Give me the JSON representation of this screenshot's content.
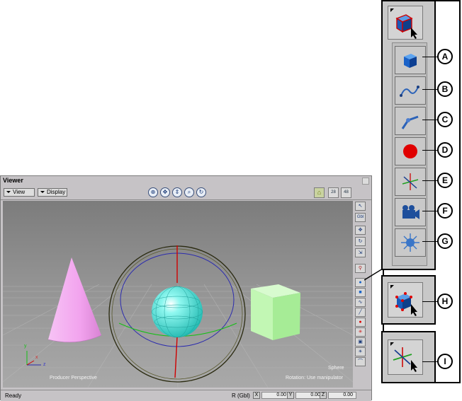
{
  "viewer": {
    "title": "Viewer",
    "menus": [
      {
        "label": "View"
      },
      {
        "label": "Display"
      }
    ],
    "nav_icons": [
      "pan-icon",
      "track-icon",
      "dolly-icon",
      "zoom-icon",
      "orbit-icon"
    ],
    "right_tools": {
      "snap": "⌂",
      "frame": "28",
      "grid": "48"
    },
    "viewport": {
      "camera_label": "Producer Perspective",
      "selection_label": "Sphere",
      "rotation_hint": "Rotation: Use manipulator",
      "axis_labels": {
        "x": "x",
        "y": "y",
        "z": "z"
      }
    },
    "mini_toolbar": {
      "items": [
        {
          "icon": "select-arrow-icon",
          "glyph": "↖"
        },
        {
          "icon": "global-local-icon",
          "glyph": "Gbl"
        },
        {
          "icon": "translate-icon",
          "glyph": "✥"
        },
        {
          "icon": "rotate-icon",
          "glyph": "↻"
        },
        {
          "icon": "scale-icon",
          "glyph": "⇲"
        },
        {
          "icon": "magnet-icon",
          "glyph": "⚲"
        },
        {
          "icon": "create-primitive-icon",
          "glyph": "●"
        },
        {
          "icon": "cube-icon",
          "glyph": "■"
        },
        {
          "icon": "curve-icon",
          "glyph": "∿"
        },
        {
          "icon": "skeleton-icon",
          "glyph": "╱"
        },
        {
          "icon": "marker-icon",
          "glyph": "●"
        },
        {
          "icon": "null-icon",
          "glyph": "✳"
        },
        {
          "icon": "camera-icon",
          "glyph": "▣"
        },
        {
          "icon": "light-icon",
          "glyph": "☀"
        },
        {
          "icon": "path-icon",
          "glyph": "⌒"
        }
      ]
    },
    "status": {
      "text": "Ready",
      "coord_mode": "R (Gbl)",
      "x_label": "X",
      "x_value": "0.00",
      "y_label": "Y",
      "y_value": "0.00",
      "z_label": "Z",
      "z_value": "0.00"
    }
  },
  "callouts": {
    "items": [
      {
        "letter": "A",
        "icon": "cube-icon",
        "color": "#1560c8"
      },
      {
        "letter": "B",
        "icon": "curve-icon",
        "color": "#2b62b8"
      },
      {
        "letter": "C",
        "icon": "skeleton-icon",
        "color": "#2b62b8"
      },
      {
        "letter": "D",
        "icon": "marker-icon",
        "color": "#e00000"
      },
      {
        "letter": "E",
        "icon": "null-icon",
        "color": "#cc2020"
      },
      {
        "letter": "F",
        "icon": "camera-icon",
        "color": "#1e4f9c"
      },
      {
        "letter": "G",
        "icon": "light-icon",
        "color": "#3a76c8"
      },
      {
        "letter": "H",
        "icon": "primitive-select-icon",
        "color": "#1560c8"
      },
      {
        "letter": "I",
        "icon": "null-select-icon",
        "color": "#cc2020"
      }
    ]
  },
  "colors": {
    "cone": "#f3a6ef",
    "sphere": "#5ff0e6",
    "cube": "#b6f5a8",
    "manipulator_outer": "#2a2a10",
    "manipulator_blue": "#2c2cae",
    "manipulator_red": "#d00000",
    "manipulator_green": "#14c014"
  }
}
